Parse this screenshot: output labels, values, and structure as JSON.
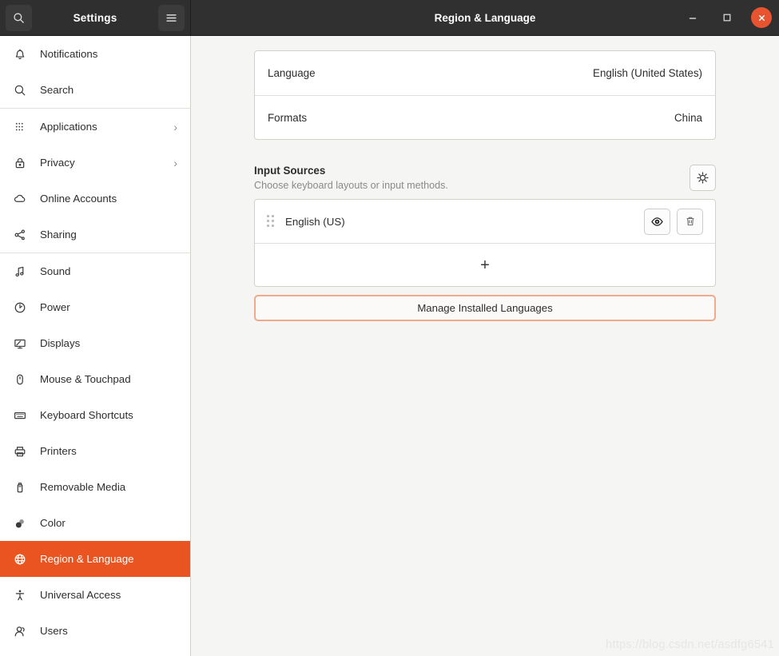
{
  "titlebar": {
    "sidebar_title": "Settings",
    "main_title": "Region & Language",
    "search_icon": "search-icon",
    "menu_icon": "hamburger-menu-icon",
    "minimize_label": "–",
    "maximize_label": "□",
    "close_label": "✕"
  },
  "sidebar": {
    "items": [
      {
        "label": "Notifications",
        "icon": "bell-icon",
        "chevron": "",
        "active": false,
        "sep_after": false
      },
      {
        "label": "Search",
        "icon": "search-icon",
        "chevron": "",
        "active": false,
        "sep_after": true
      },
      {
        "label": "Applications",
        "icon": "grid-dots-icon",
        "chevron": "›",
        "active": false,
        "sep_after": false
      },
      {
        "label": "Privacy",
        "icon": "lock-icon",
        "chevron": "›",
        "active": false,
        "sep_after": false
      },
      {
        "label": "Online Accounts",
        "icon": "cloud-icon",
        "chevron": "",
        "active": false,
        "sep_after": false
      },
      {
        "label": "Sharing",
        "icon": "share-nodes-icon",
        "chevron": "",
        "active": false,
        "sep_after": true
      },
      {
        "label": "Sound",
        "icon": "music-note-icon",
        "chevron": "",
        "active": false,
        "sep_after": false
      },
      {
        "label": "Power",
        "icon": "power-icon",
        "chevron": "",
        "active": false,
        "sep_after": false
      },
      {
        "label": "Displays",
        "icon": "monitor-icon",
        "chevron": "",
        "active": false,
        "sep_after": false
      },
      {
        "label": "Mouse & Touchpad",
        "icon": "mouse-icon",
        "chevron": "",
        "active": false,
        "sep_after": false
      },
      {
        "label": "Keyboard Shortcuts",
        "icon": "keyboard-icon",
        "chevron": "",
        "active": false,
        "sep_after": false
      },
      {
        "label": "Printers",
        "icon": "printer-icon",
        "chevron": "",
        "active": false,
        "sep_after": false
      },
      {
        "label": "Removable Media",
        "icon": "usb-drive-icon",
        "chevron": "",
        "active": false,
        "sep_after": false
      },
      {
        "label": "Color",
        "icon": "color-circles-icon",
        "chevron": "",
        "active": false,
        "sep_after": false
      },
      {
        "label": "Region & Language",
        "icon": "globe-icon",
        "chevron": "",
        "active": true,
        "sep_after": false
      },
      {
        "label": "Universal Access",
        "icon": "accessibility-icon",
        "chevron": "",
        "active": false,
        "sep_after": false
      },
      {
        "label": "Users",
        "icon": "user-icon",
        "chevron": "",
        "active": false,
        "sep_after": false
      }
    ]
  },
  "main": {
    "settings_rows": [
      {
        "label": "Language",
        "value": "English (United States)"
      },
      {
        "label": "Formats",
        "value": "China"
      }
    ],
    "input_sources": {
      "title": "Input Sources",
      "subtitle": "Choose keyboard layouts or input methods.",
      "settings_icon": "gear-icon",
      "sources": [
        {
          "name": "English (US)",
          "preview_icon": "eye-icon",
          "remove_icon": "trash-icon"
        }
      ],
      "add_label": "+"
    },
    "manage_button": "Manage Installed Languages"
  },
  "watermark": "https://blog.csdn.net/asdfg6541",
  "colors": {
    "accent": "#e95420",
    "titlebar": "#303030",
    "sidebar_bg": "#ffffff",
    "main_bg": "#f5f5f4",
    "focus_border": "#f0a98a"
  }
}
